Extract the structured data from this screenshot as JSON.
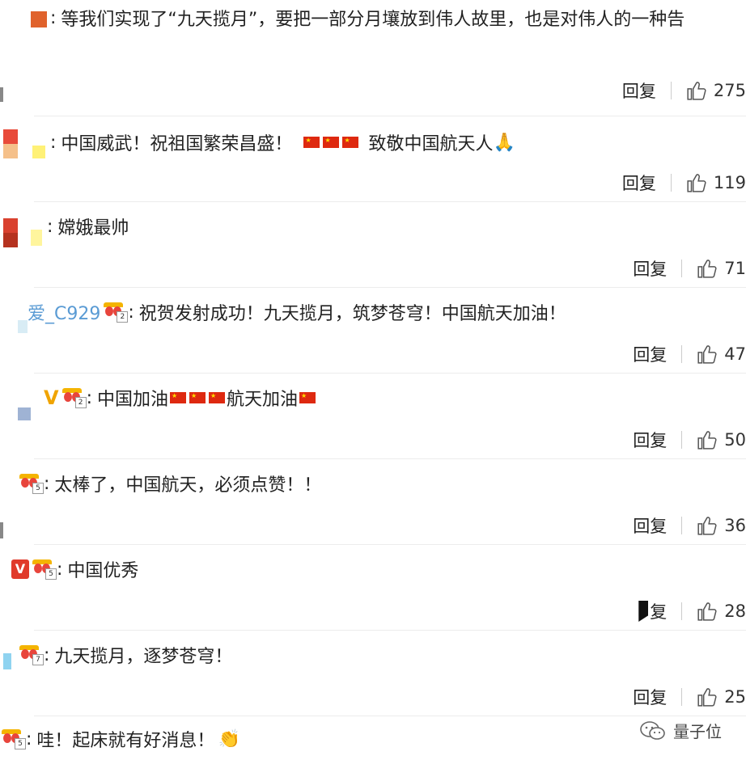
{
  "comments": [
    {
      "text": "等我们实现了“九天揽月”，要把一部分月壤放到伟人故里，也是对伟人的一种告",
      "reply": "回复",
      "likes": "275"
    },
    {
      "text": "中国威武！祝祖国繁荣昌盛！",
      "text2": "致敬中国航天人",
      "reply": "回复",
      "likes": "119"
    },
    {
      "text": "嫦娥最帅",
      "reply": "回复",
      "likes": "71"
    },
    {
      "username": "爱_C929",
      "text": "祝贺发射成功！九天揽月，筑梦苍穹！中国航天加油！",
      "reply": "回复",
      "likes": "47"
    },
    {
      "text": "中国加油",
      "text2": "航天加油",
      "reply": "回复",
      "likes": "50"
    },
    {
      "text": "太棒了，中国航天，必须点赞！！",
      "reply": "回复",
      "likes": "36"
    },
    {
      "text": "中国优秀",
      "reply": "复",
      "likes": "28"
    },
    {
      "text": "九天揽月，逐梦苍穹！",
      "reply": "回复",
      "likes": "25"
    },
    {
      "text": "哇！起床就有好消息！"
    }
  ],
  "icons": {
    "thumb": "thumbs-up-icon",
    "crown": "fan-crown-badge-icon",
    "flag": "china-flag-emoji",
    "clap": "clapping-hands-emoji",
    "pray": "folded-hands-emoji",
    "wechat": "wechat-logo-icon"
  },
  "levels": {
    "c4": "2",
    "c5": "2",
    "c6": "5",
    "c7": "5",
    "c8": "7",
    "c9": "5"
  },
  "watermark": "量子位",
  "colors": {
    "username": "#5a9bd4",
    "divider": "#ececec",
    "badge_red": "#e8453c",
    "badge_gold": "#f4b400"
  }
}
